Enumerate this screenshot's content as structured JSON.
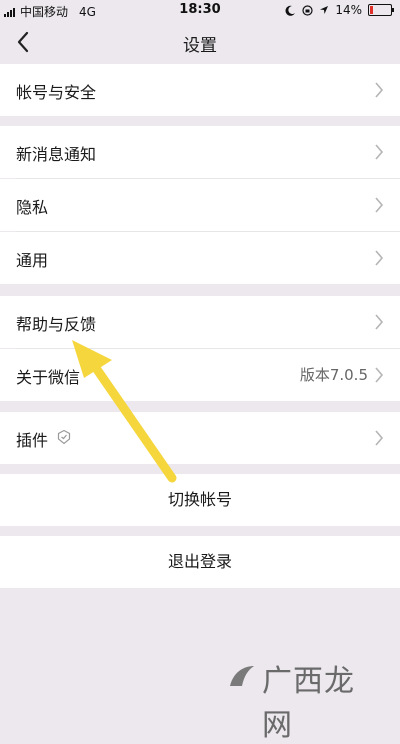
{
  "status_bar": {
    "carrier": "中国移动",
    "network": "4G",
    "time": "18:30",
    "battery_percent": "14%",
    "battery_level": 0.14
  },
  "nav": {
    "title": "设置",
    "back_icon": "chevron-left-icon"
  },
  "sections": {
    "account": {
      "label": "帐号与安全"
    },
    "notifications": {
      "label": "新消息通知"
    },
    "privacy": {
      "label": "隐私"
    },
    "general": {
      "label": "通用"
    },
    "help": {
      "label": "帮助与反馈"
    },
    "about": {
      "label": "关于微信",
      "value": "版本7.0.5"
    },
    "plugins": {
      "label": "插件"
    }
  },
  "actions": {
    "switch_account": "切换帐号",
    "logout": "退出登录"
  },
  "watermark": {
    "text": "广西龙网"
  },
  "colors": {
    "page_bg": "#ece8ee",
    "arrow": "#f5d63d",
    "battery_low": "#e0322b"
  }
}
